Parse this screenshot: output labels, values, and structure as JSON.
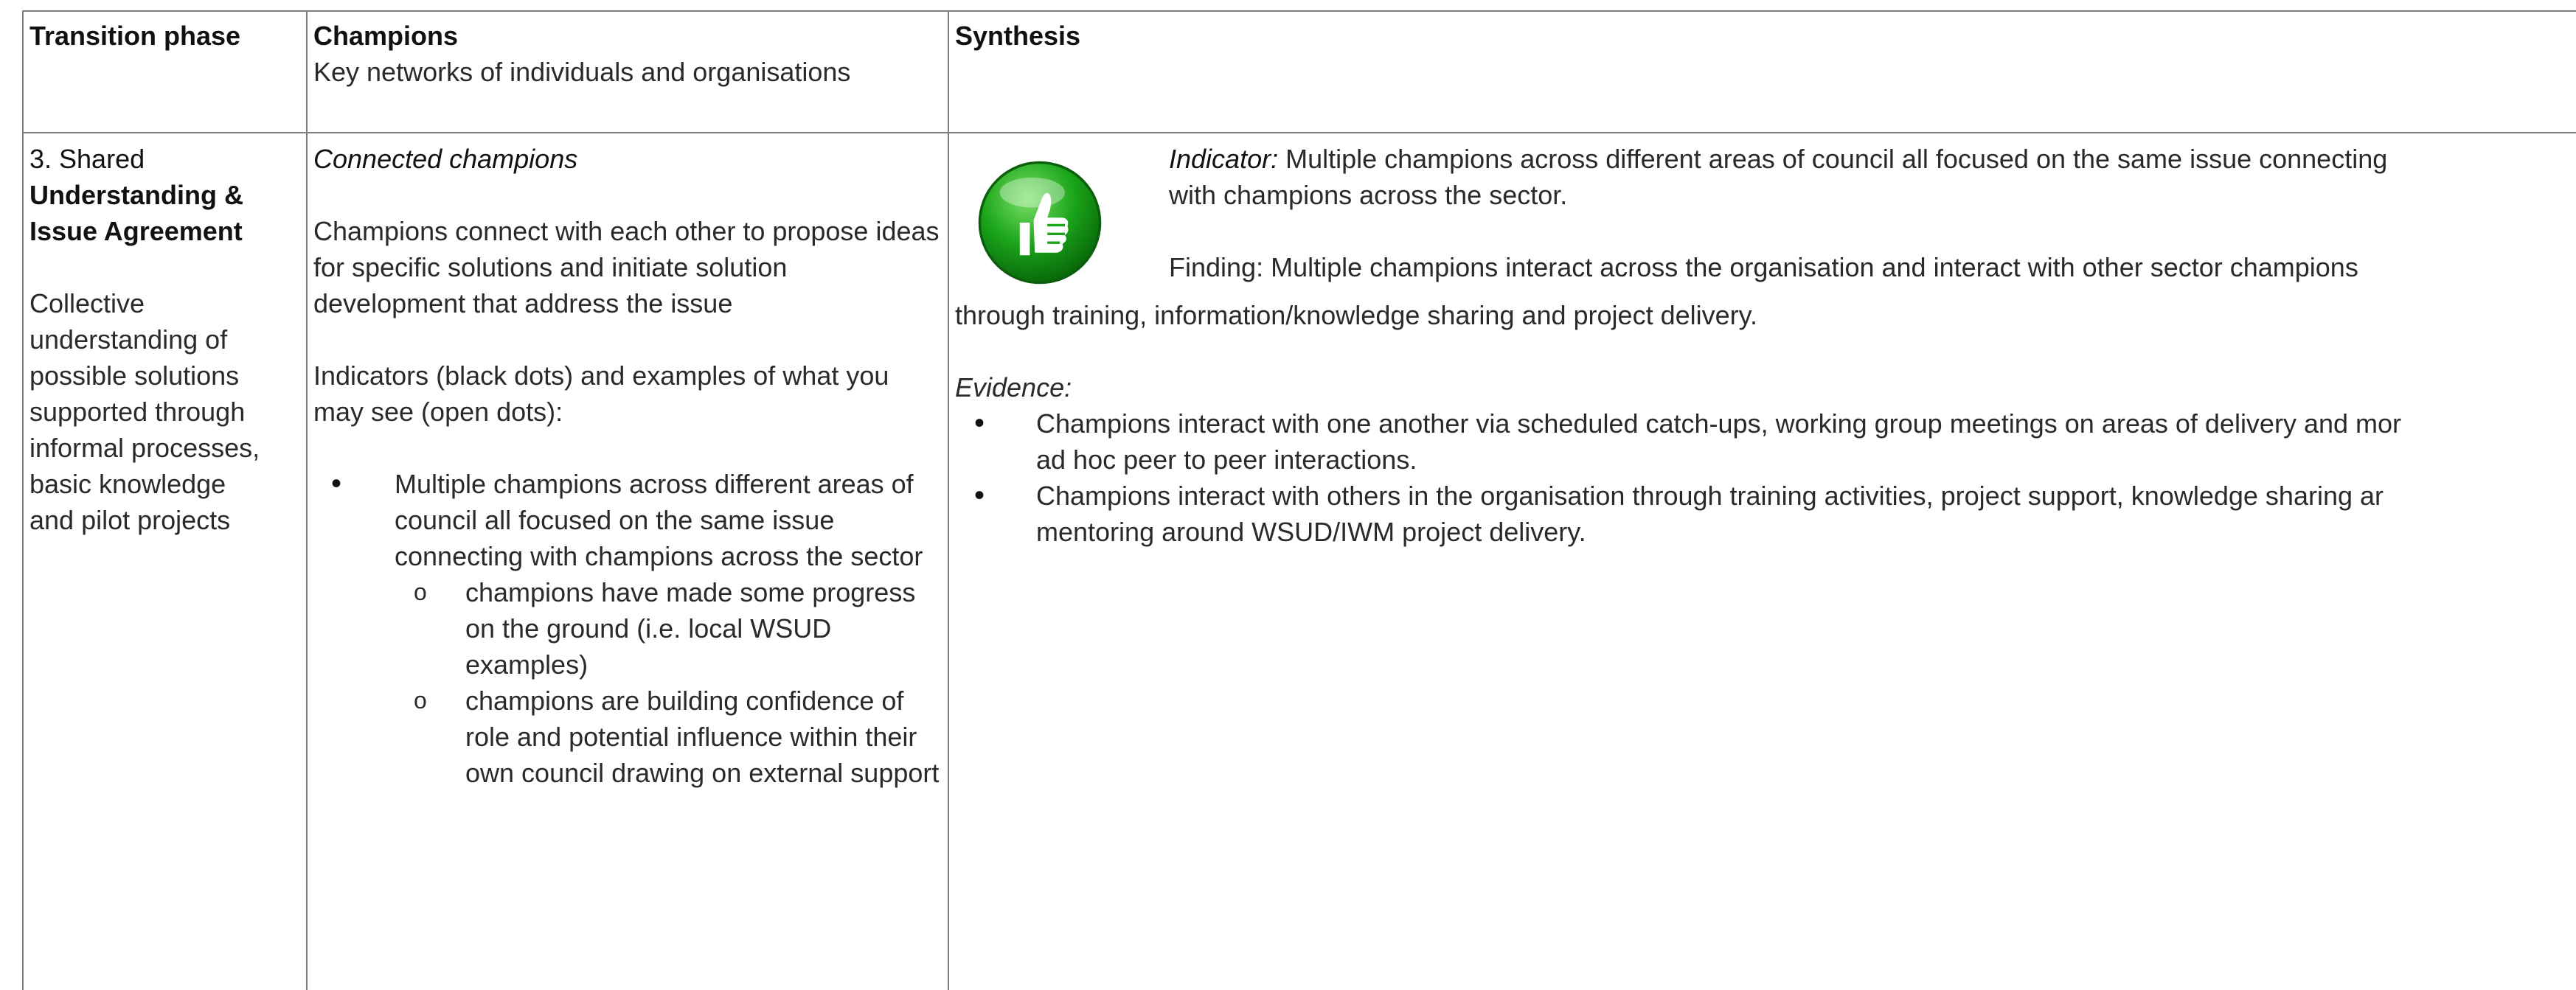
{
  "table": {
    "headers": {
      "phase": "Transition phase",
      "champions_title": "Champions",
      "champions_subtitle": "Key networks of individuals and organisations",
      "synthesis": "Synthesis"
    },
    "phase": {
      "title_line1": "3. Shared",
      "title_line2": "Understanding &",
      "title_line3": "Issue Agreement",
      "desc_lines": [
        "Collective",
        "understanding of",
        "possible solutions",
        "supported through",
        "informal processes,",
        "basic knowledge",
        "and pilot projects"
      ]
    },
    "champions": {
      "heading": "Connected champions",
      "para1": "Champions connect with each other to propose ideas for specific solutions and initiate solution development that address the issue",
      "para2": "Indicators (black dots) and examples of what you may see (open dots):",
      "bullet": "Multiple champions across different areas of council all focused on the same issue connecting with champions across the sector",
      "subs": [
        "champions have made some progress on the ground (i.e. local WSUD examples)",
        "champions are building confidence of role and potential influence within their own council drawing on external support"
      ]
    },
    "synthesis": {
      "icon": "thumbs-up-icon",
      "icon_color": "#1aa51a",
      "indicator_label": "Indicator:",
      "indicator_line1": " Multiple champions across different areas of council all focused on the same issue connecting",
      "indicator_line2": "with champions across the sector.",
      "finding_line1": "Finding:  Multiple champions interact across the organisation and interact with other sector champions",
      "finding_line2": "through training, information/knowledge sharing and project delivery.",
      "evidence_label": "Evidence:",
      "evidence": [
        {
          "line1": "Champions interact with one another via scheduled catch-ups, working group meetings on areas of delivery and mor",
          "line2": "ad hoc peer to peer interactions."
        },
        {
          "line1": "Champions interact with others in the organisation through training activities, project support, knowledge sharing ar",
          "line2": "mentoring around WSUD/IWM project delivery."
        }
      ]
    }
  }
}
